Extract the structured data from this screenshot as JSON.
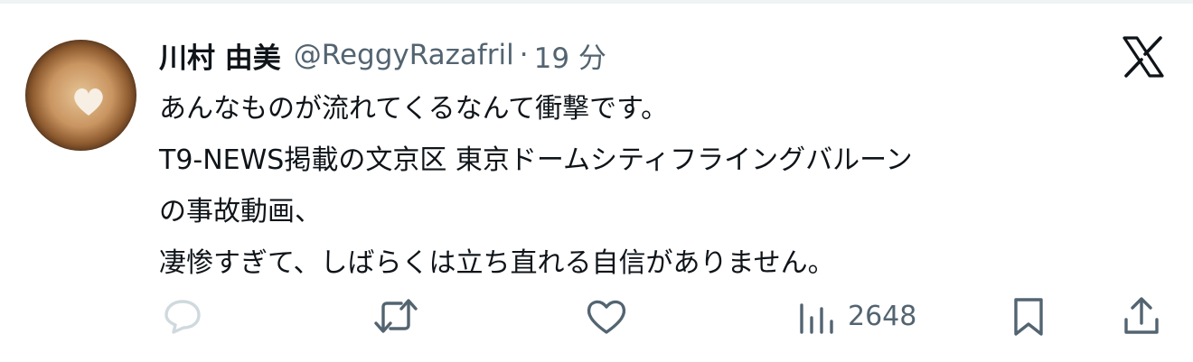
{
  "author": {
    "name": "川村 由美",
    "handle": "@ReggyRazafril",
    "separator": "·",
    "time": "19 分"
  },
  "tweet_lines": [
    "あんなものが流れてくるなんて衝撃です。",
    "T9-NEWS掲載の文京区 東京ドームシティフライングバルーン",
    "の事故動画、",
    "凄惨すぎて、しばらくは立ち直れる自信がありません。"
  ],
  "actions": {
    "reply": {
      "icon": "reply-icon"
    },
    "retweet": {
      "icon": "retweet-icon"
    },
    "like": {
      "icon": "heart-icon"
    },
    "views": {
      "icon": "views-icon",
      "count": "2648"
    },
    "bookmark": {
      "icon": "bookmark-icon"
    },
    "share": {
      "icon": "share-icon"
    }
  },
  "logo": {
    "icon": "x-logo-icon"
  },
  "colors": {
    "text": "#0f1419",
    "secondary": "#536471",
    "reply_icon": "#cfd9de"
  }
}
